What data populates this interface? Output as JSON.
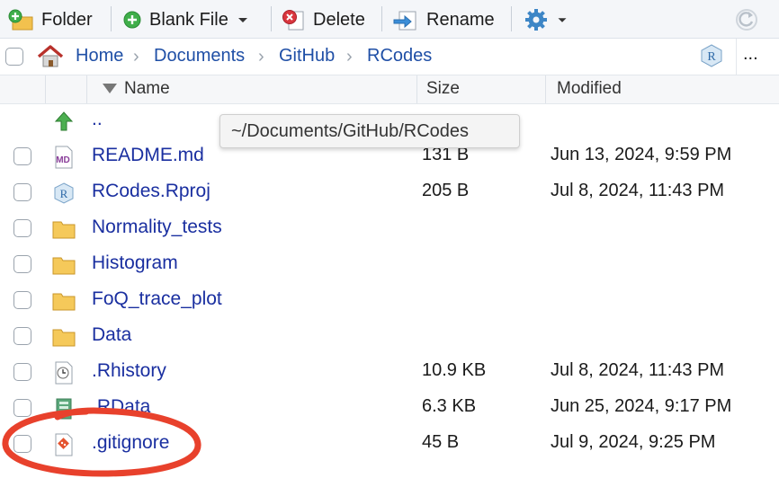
{
  "toolbar": {
    "folder_label": "Folder",
    "blank_file_label": "Blank File",
    "delete_label": "Delete",
    "rename_label": "Rename"
  },
  "breadcrumb": {
    "items": [
      "Home",
      "Documents",
      "GitHub",
      "RCodes"
    ],
    "more_label": "..."
  },
  "columns": {
    "name": "Name",
    "size": "Size",
    "modified": "Modified"
  },
  "parent_dir_label": "..",
  "tooltip_text": "~/Documents/GitHub/RCodes",
  "files": [
    {
      "name": "README.md",
      "size": "131 B",
      "modified": "Jun 13, 2024, 9:59 PM",
      "icon": "markdown-file-icon"
    },
    {
      "name": "RCodes.Rproj",
      "size": "205 B",
      "modified": "Jul 8, 2024, 11:43 PM",
      "icon": "rproj-file-icon"
    },
    {
      "name": "Normality_tests",
      "size": "",
      "modified": "",
      "icon": "folder-icon"
    },
    {
      "name": "Histogram",
      "size": "",
      "modified": "",
      "icon": "folder-icon"
    },
    {
      "name": "FoQ_trace_plot",
      "size": "",
      "modified": "",
      "icon": "folder-icon"
    },
    {
      "name": "Data",
      "size": "",
      "modified": "",
      "icon": "folder-icon"
    },
    {
      "name": ".Rhistory",
      "size": "10.9 KB",
      "modified": "Jul 8, 2024, 11:43 PM",
      "icon": "history-file-icon"
    },
    {
      "name": ".RData",
      "size": "6.3 KB",
      "modified": "Jun 25, 2024, 9:17 PM",
      "icon": "rdata-file-icon"
    },
    {
      "name": ".gitignore",
      "size": "45 B",
      "modified": "Jul 9, 2024, 9:25 PM",
      "icon": "gitignore-file-icon"
    }
  ],
  "colors": {
    "link_blue": "#1a2fa0",
    "crumb_blue": "#1f4fa6",
    "annotation_red": "#e8412c",
    "toolbar_bg": "#f4f6f9"
  }
}
